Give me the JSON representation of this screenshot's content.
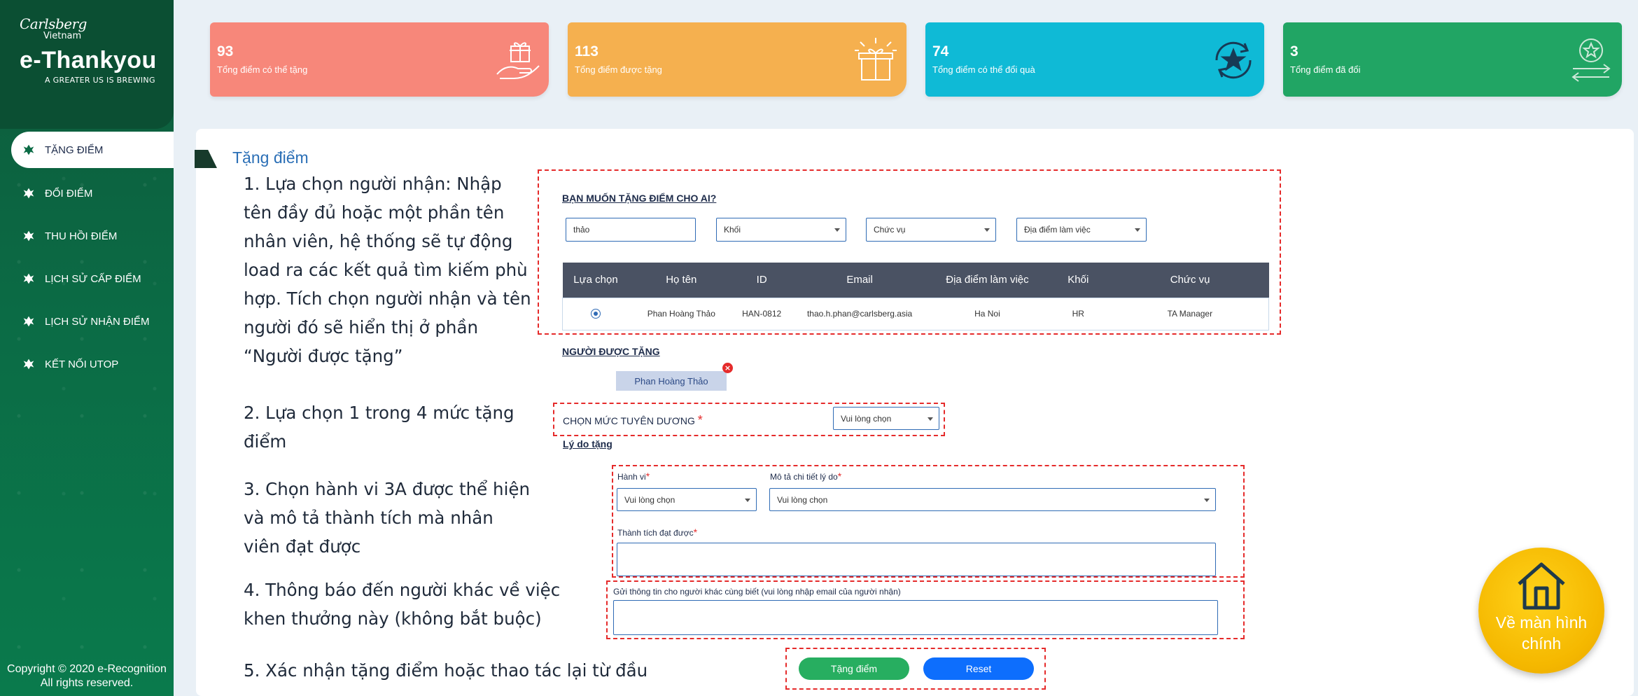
{
  "brand": {
    "logo_script": "Carlsberg",
    "logo_sub": "Vietnam",
    "app_name": "e-Thankyou",
    "tagline": "A GREATER US IS BREWING"
  },
  "menu": [
    {
      "label": "Tặng điểm",
      "icon": "leaf-icon",
      "active": true
    },
    {
      "label": "Đổi điểm",
      "icon": "leaf-icon",
      "active": false
    },
    {
      "label": "Thu hồi điểm",
      "icon": "leaf-icon",
      "active": false
    },
    {
      "label": "Lịch sử cấp điểm",
      "icon": "leaf-icon",
      "active": false
    },
    {
      "label": "Lịch sử nhận điểm",
      "icon": "leaf-icon",
      "active": false
    },
    {
      "label": "Kết nối Utop",
      "icon": "leaf-icon",
      "active": false
    }
  ],
  "copyright": {
    "line1": "Copyright © 2020 e-Recognition",
    "line2": "All rights reserved."
  },
  "stats": [
    {
      "value": "93",
      "label": "Tổng điểm có thể tặng",
      "color": "#f7877a",
      "icon": "gift-hand-icon"
    },
    {
      "value": "113",
      "label": "Tổng điểm được tặng",
      "color": "#f5b04f",
      "icon": "gift-sparkle-icon"
    },
    {
      "value": "74",
      "label": "Tổng điểm có thể đổi quà",
      "color": "#0fbad6",
      "icon": "star-cycle-icon"
    },
    {
      "value": "3",
      "label": "Tổng điểm đã đổi",
      "color": "#21a564",
      "icon": "star-exchange-icon"
    }
  ],
  "page_title": "Tặng điểm",
  "instructions": {
    "step1": "1. Lựa chọn người nhận: Nhập tên đầy đủ hoặc một phần tên nhân viên, hệ thống sẽ tự động load ra các kết quả tìm kiếm phù hợp. Tích chọn người nhận và tên người đó sẽ hiển thị ở phần “Người được tặng”",
    "step2": "2. Lựa chọn 1 trong 4 mức tặng điểm",
    "step3": "3. Chọn hành vi 3A được thể hiện và mô tả thành tích mà nhân viên đạt được",
    "step4": "4. Thông báo đến người khác về việc khen thưởng này (không bắt buộc)",
    "step5": "5. Xác nhận tặng điểm hoặc thao tác lại từ đầu"
  },
  "search": {
    "heading": "Bạn muốn tặng điểm cho ai?",
    "name_value": "thảo",
    "khoi": "Khối",
    "chuc_vu": "Chức vụ",
    "dia_diem": "Địa điểm làm việc"
  },
  "table": {
    "headers": [
      "Lựa chọn",
      "Họ tên",
      "ID",
      "Email",
      "Địa điểm làm việc",
      "Khối",
      "Chức vụ"
    ],
    "rows": [
      {
        "selected": true,
        "name": "Phan Hoàng Thảo",
        "id": "HAN-0812",
        "email": "thao.h.phan@carlsberg.asia",
        "location": "Ha Noi",
        "division": "HR",
        "position": "TA Manager"
      }
    ]
  },
  "recipient": {
    "heading": "Người được tặng",
    "chip": "Phan Hoàng Thảo",
    "remove": "×"
  },
  "level": {
    "label": "CHỌN MỨC TUYÊN DƯƠNG",
    "value": "Vui lòng chọn"
  },
  "reason": {
    "heading": "Lý do tặng",
    "behavior_label": "Hành vi",
    "behavior_value": "Vui lòng chọn",
    "detail_label": "Mô tả chi tiết lý do",
    "detail_value": "Vui lòng chọn",
    "achievement_label": "Thành tích đạt được",
    "achievement_value": ""
  },
  "notify": {
    "label": "Gửi thông tin cho người khác cùng biết (vui lòng nhập email của người nhận)",
    "value": ""
  },
  "actions": {
    "submit": "Tặng điểm",
    "reset": "Reset",
    "submit_color": "#27ae60",
    "reset_color": "#0d6efd"
  },
  "home": {
    "label": "Về màn hình chính"
  },
  "required_mark": "*"
}
